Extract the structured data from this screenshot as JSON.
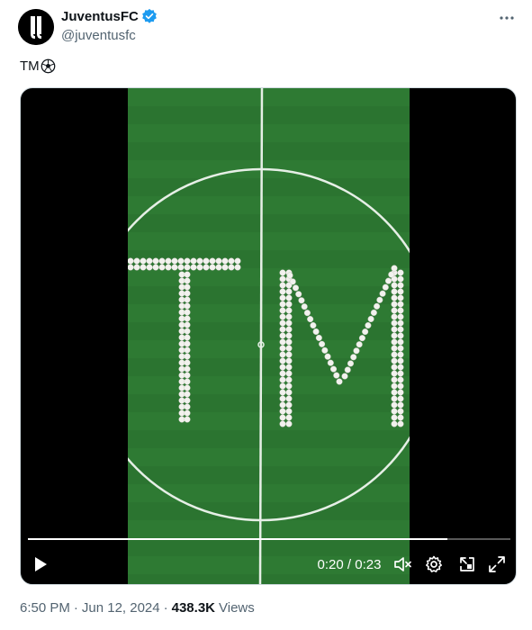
{
  "author": {
    "display_name": "JuventusFC",
    "handle": "@juventusfc",
    "verified": true
  },
  "tweet": {
    "text": "TM",
    "emoji_icon": "soccer-ball-icon"
  },
  "video": {
    "current_time": "0:20",
    "duration": "0:23",
    "time_display": "0:20 / 0:23",
    "progress_fraction": 0.87,
    "letters_on_pitch": "TM"
  },
  "meta": {
    "time": "6:50 PM",
    "separator": "·",
    "date": "Jun 12, 2024",
    "views_count": "438.3K",
    "views_label": "Views"
  },
  "colors": {
    "accent_verified": "#1d9bf0",
    "pitch_green": "#2f7d34",
    "text_secondary": "#536471"
  }
}
